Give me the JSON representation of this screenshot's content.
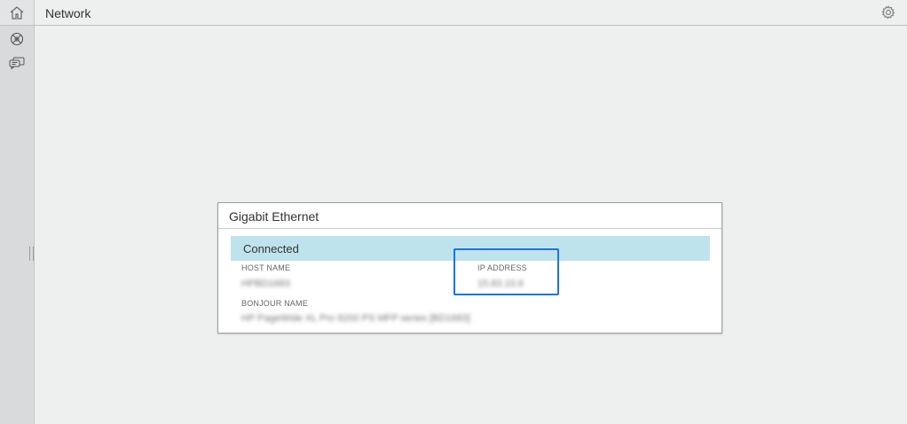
{
  "header": {
    "title": "Network"
  },
  "sidebar": {
    "items": [
      {
        "icon": "home-icon"
      },
      {
        "icon": "network-icon"
      },
      {
        "icon": "chat-icon"
      }
    ]
  },
  "card": {
    "title": "Gigabit Ethernet",
    "status": "Connected",
    "fields": [
      {
        "label": "HOST NAME",
        "value": "HPBD1683"
      },
      {
        "label": "IP ADDRESS",
        "value": "15.83.10.6"
      },
      {
        "label": "BONJOUR NAME",
        "value": "HP PageWide XL Pro 8200 PS MFP series [BD1683]"
      }
    ]
  },
  "colors": {
    "accent": "#1a73e8",
    "status_bg": "#bfe3ec",
    "background": "#eeefef",
    "sidebar": "#d9dadb"
  }
}
